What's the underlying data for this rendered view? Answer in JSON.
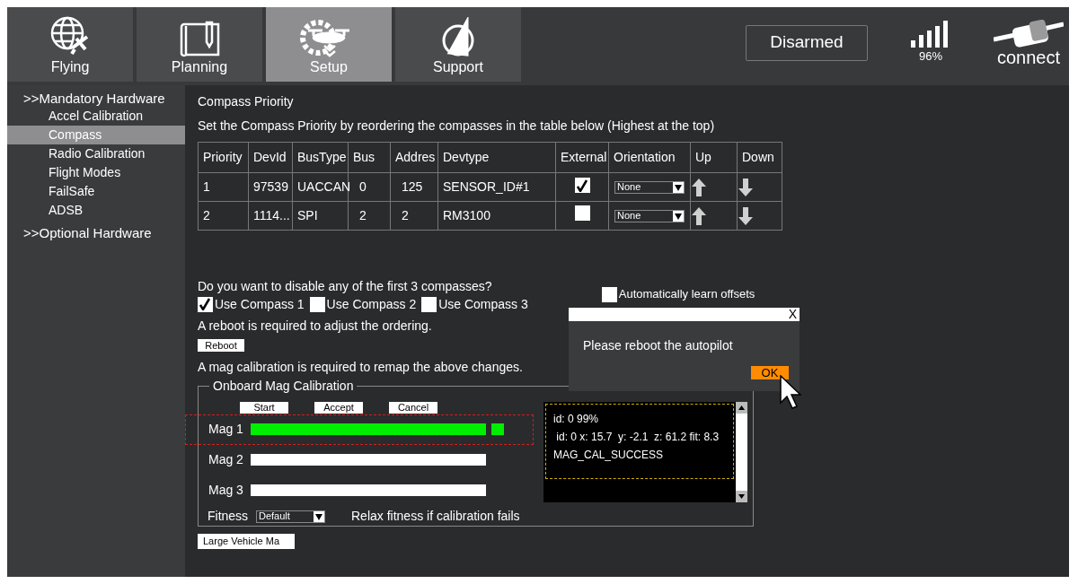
{
  "nav_tabs": [
    {
      "label": "Flying",
      "kind": "globe",
      "selected": false
    },
    {
      "label": "Planning",
      "kind": "map",
      "selected": false
    },
    {
      "label": "Setup",
      "kind": "gear",
      "selected": true
    },
    {
      "label": "Support",
      "kind": "sail",
      "selected": false
    }
  ],
  "status": {
    "arm_state": "Disarmed",
    "signal": "96%",
    "connect": "connect"
  },
  "sidebar": {
    "sections": [
      {
        "label": ">>Mandatory Hardware",
        "children": [
          {
            "label": "Accel Calibration",
            "selected": false
          },
          {
            "label": "Compass",
            "selected": true
          },
          {
            "label": "Radio Calibration",
            "selected": false
          },
          {
            "label": "Flight Modes",
            "selected": false
          },
          {
            "label": "FailSafe",
            "selected": false
          },
          {
            "label": "ADSB",
            "selected": false
          }
        ]
      },
      {
        "label": ">>Optional Hardware"
      }
    ]
  },
  "title": "Compass Priority",
  "instructions": "Set the Compass Priority by reordering the compasses in the table below (Highest at the top)",
  "table": {
    "columns": [
      "Priority",
      "DevId",
      "BusType",
      "Bus",
      "Addres",
      "Devtype",
      "External",
      "Orientation",
      "Up",
      "Down"
    ],
    "rows": [
      {
        "priority": "1",
        "devid": "97539",
        "bustype": "UACCAN",
        "bus": "0",
        "address": "125",
        "devtype": "SENSOR_ID#1",
        "external": true,
        "orientation": "None"
      },
      {
        "priority": "2",
        "devid": "1114...",
        "bustype": "SPI",
        "bus": "2",
        "address": "2",
        "devtype": "RM3100",
        "external": false,
        "orientation": "None"
      }
    ]
  },
  "disable_prompt": "Do you want to disable any of the first 3 compasses?",
  "use_compass": [
    {
      "label": "Use Compass 1",
      "checked": true
    },
    {
      "label": "Use Compass 2",
      "checked": false
    },
    {
      "label": "Use Compass 3",
      "checked": false
    }
  ],
  "auto_learn": {
    "label": "Automatically learn offsets",
    "checked": false
  },
  "reboot_note": "A reboot is required to adjust the ordering.",
  "reboot_button": "Reboot",
  "remap_note": "A mag calibration is required to remap the above changes.",
  "calibration": {
    "title": "Onboard Mag Calibration",
    "buttons": [
      "Start",
      "Accept",
      "Cancel"
    ],
    "mags": [
      {
        "label": "Mag 1",
        "level": 1,
        "done": true,
        "highlighted": true
      },
      {
        "label": "Mag 2",
        "level": 0,
        "done": false,
        "highlighted": false
      },
      {
        "label": "Mag 3",
        "level": 0,
        "done": false,
        "highlighted": false
      }
    ],
    "fitness_label": "Fitness",
    "fitness_value": "Default",
    "relax_label": "Relax fitness if calibration fails",
    "log": [
      "id: 0 99%",
      " id: 0 x: 15.7  y: -2.1  z: 61.2 fit: 8.3",
      "MAG_CAL_SUCCESS"
    ]
  },
  "large_vehicle_button": "Large Vehicle Ma",
  "dialog": {
    "message": "Please reboot the autopilot",
    "close": "X",
    "ok": "OK"
  }
}
